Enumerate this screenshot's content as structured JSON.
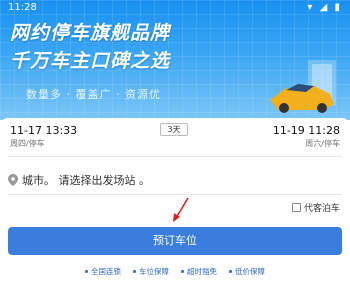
{
  "status_bar": {
    "time": "11:28",
    "icons": "▾ ◢ ▮"
  },
  "banner": {
    "headline_1": "网约停车旗舰品牌",
    "headline_2": "千万车主口碑之选",
    "tagline": "数量多 · 覆盖广 · 资源优",
    "colors": {
      "top": "#1890f0",
      "bottom": "#7cc6f6"
    }
  },
  "booking": {
    "start": {
      "datetime": "11-17 13:33",
      "weekday_label": "周四/停车"
    },
    "days_badge": "3天",
    "end": {
      "datetime": "11-19 11:28",
      "weekday_label": "周六/停车"
    },
    "location_text": "城市。 请选择出发场站 。",
    "valet_label": "代客泊车",
    "book_button": "预订车位",
    "accent_color": "#3b7ddd"
  },
  "features": [
    "全国连锁",
    "车位保障",
    "超时豁免",
    "低价保障"
  ]
}
